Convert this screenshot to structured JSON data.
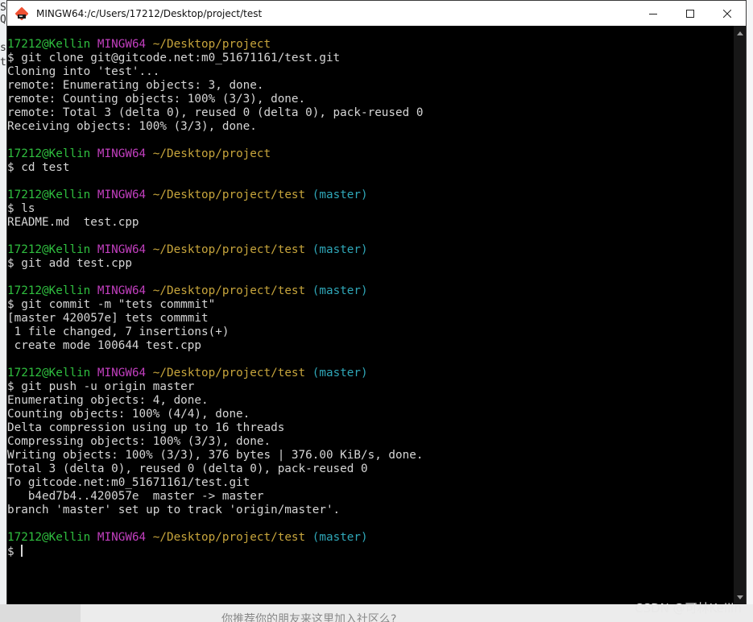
{
  "window": {
    "title": "MINGW64:/c/Users/17212/Desktop/project/test"
  },
  "background": {
    "left_fragments": [
      "S",
      "Q",
      "s",
      "t"
    ],
    "bottom_text": "你推荐你的朋友来这里加入社区么?"
  },
  "terminal": {
    "lines": [
      {
        "type": "prompt",
        "user": "17212@Kellin",
        "env": "MINGW64",
        "path": "~/Desktop/project",
        "branch": ""
      },
      {
        "type": "out",
        "text": "$ git clone git@gitcode.net:m0_51671161/test.git"
      },
      {
        "type": "out",
        "text": "Cloning into 'test'..."
      },
      {
        "type": "out",
        "text": "remote: Enumerating objects: 3, done."
      },
      {
        "type": "out",
        "text": "remote: Counting objects: 100% (3/3), done."
      },
      {
        "type": "out",
        "text": "remote: Total 3 (delta 0), reused 0 (delta 0), pack-reused 0"
      },
      {
        "type": "out",
        "text": "Receiving objects: 100% (3/3), done."
      },
      {
        "type": "out",
        "text": ""
      },
      {
        "type": "prompt",
        "user": "17212@Kellin",
        "env": "MINGW64",
        "path": "~/Desktop/project",
        "branch": ""
      },
      {
        "type": "out",
        "text": "$ cd test"
      },
      {
        "type": "out",
        "text": ""
      },
      {
        "type": "prompt",
        "user": "17212@Kellin",
        "env": "MINGW64",
        "path": "~/Desktop/project/test",
        "branch": "(master)"
      },
      {
        "type": "out",
        "text": "$ ls"
      },
      {
        "type": "out",
        "text": "README.md  test.cpp"
      },
      {
        "type": "out",
        "text": ""
      },
      {
        "type": "prompt",
        "user": "17212@Kellin",
        "env": "MINGW64",
        "path": "~/Desktop/project/test",
        "branch": "(master)"
      },
      {
        "type": "out",
        "text": "$ git add test.cpp"
      },
      {
        "type": "out",
        "text": ""
      },
      {
        "type": "prompt",
        "user": "17212@Kellin",
        "env": "MINGW64",
        "path": "~/Desktop/project/test",
        "branch": "(master)"
      },
      {
        "type": "out",
        "text": "$ git commit -m \"tets commmit\""
      },
      {
        "type": "out",
        "text": "[master 420057e] tets commmit"
      },
      {
        "type": "out",
        "text": " 1 file changed, 7 insertions(+)"
      },
      {
        "type": "out",
        "text": " create mode 100644 test.cpp"
      },
      {
        "type": "out",
        "text": ""
      },
      {
        "type": "prompt",
        "user": "17212@Kellin",
        "env": "MINGW64",
        "path": "~/Desktop/project/test",
        "branch": "(master)"
      },
      {
        "type": "out",
        "text": "$ git push -u origin master"
      },
      {
        "type": "out",
        "text": "Enumerating objects: 4, done."
      },
      {
        "type": "out",
        "text": "Counting objects: 100% (4/4), done."
      },
      {
        "type": "out",
        "text": "Delta compression using up to 16 threads"
      },
      {
        "type": "out",
        "text": "Compressing objects: 100% (3/3), done."
      },
      {
        "type": "out",
        "text": "Writing objects: 100% (3/3), 376 bytes | 376.00 KiB/s, done."
      },
      {
        "type": "out",
        "text": "Total 3 (delta 0), reused 0 (delta 0), pack-reused 0"
      },
      {
        "type": "out",
        "text": "To gitcode.net:m0_51671161/test.git"
      },
      {
        "type": "out",
        "text": "   b4ed7b4..420057e  master -> master"
      },
      {
        "type": "out",
        "text": "branch 'master' set up to track 'origin/master'."
      },
      {
        "type": "out",
        "text": ""
      },
      {
        "type": "prompt",
        "user": "17212@Kellin",
        "env": "MINGW64",
        "path": "~/Desktop/project/test",
        "branch": "(master)"
      },
      {
        "type": "input",
        "text": "$ "
      }
    ]
  },
  "watermark": "CSDN @可林Kellin",
  "colors": {
    "user": "#2fbf3f",
    "env": "#c23fbf",
    "path": "#c7a53c",
    "branch": "#2fa7b8",
    "text": "#d6d6d6",
    "background": "#000000"
  }
}
